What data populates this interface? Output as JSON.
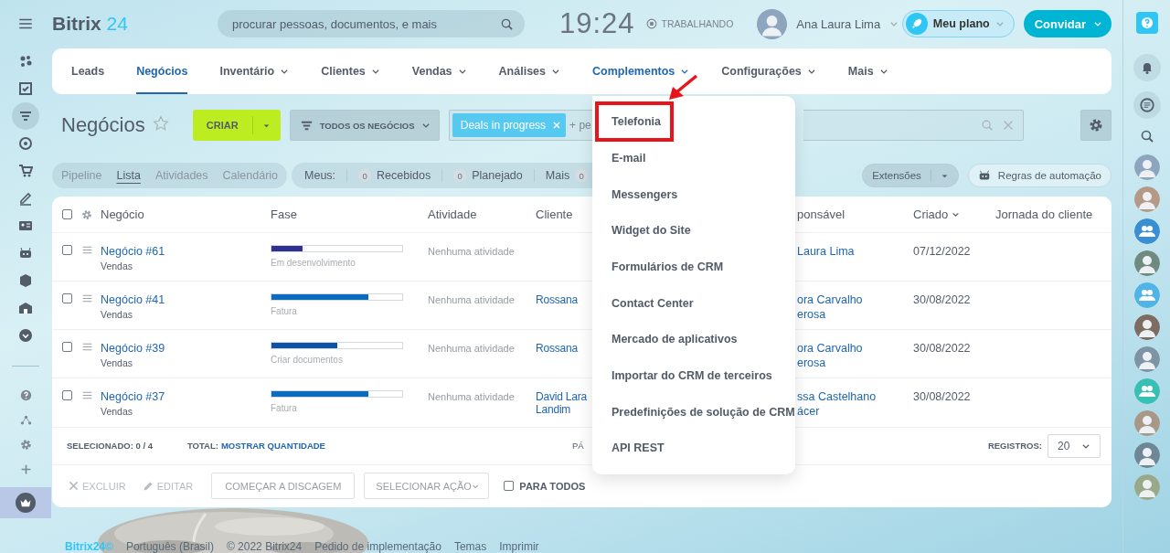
{
  "header": {
    "logo_main": "Bitrix",
    "logo_accent": "24",
    "search": {
      "placeholder": "procurar pessoas, documentos, e mais"
    },
    "clock": "19:24",
    "work_status": "TRABALHANDO",
    "user_name": "Ana Laura Lima",
    "plan_button": "Meu plano",
    "invite_button": "Convidar"
  },
  "nav_tabs": [
    {
      "label": "Leads",
      "selected": false,
      "dropdown": false
    },
    {
      "label": "Negócios",
      "selected": true,
      "dropdown": false
    },
    {
      "label": "Inventário",
      "selected": false,
      "dropdown": true
    },
    {
      "label": "Clientes",
      "selected": false,
      "dropdown": true
    },
    {
      "label": "Vendas",
      "selected": false,
      "dropdown": true
    },
    {
      "label": "Análises",
      "selected": false,
      "dropdown": true
    },
    {
      "label": "Complementos",
      "selected": false,
      "dropdown": true,
      "expanded": true
    },
    {
      "label": "Configurações",
      "selected": false,
      "dropdown": true
    },
    {
      "label": "Mais",
      "selected": false,
      "dropdown": true
    }
  ],
  "dropdown_menu": [
    {
      "label": "Telefonia",
      "highlighted": true
    },
    {
      "label": "E-mail",
      "highlighted": false
    },
    {
      "label": "Messengers",
      "highlighted": false
    },
    {
      "label": "Widget do Site",
      "highlighted": false
    },
    {
      "label": "Formulários de CRM",
      "highlighted": false
    },
    {
      "label": "Contact Center",
      "highlighted": false
    },
    {
      "label": "Mercado de aplicativos",
      "highlighted": false
    },
    {
      "label": "Importar do CRM de terceiros",
      "highlighted": false
    },
    {
      "label": "Predefinições de solução de CRM",
      "highlighted": false
    },
    {
      "label": "API REST",
      "highlighted": false
    }
  ],
  "toolbar": {
    "title": "Negócios",
    "create_button": "CRIAR",
    "filter_preset": "TODOS OS NEGÓCIOS",
    "filter_tag": "Deals in progress",
    "filter_more": "+ pe"
  },
  "view_tabs": [
    {
      "label": "Pipeline",
      "selected": false
    },
    {
      "label": "Lista",
      "selected": true
    },
    {
      "label": "Atividades",
      "selected": false
    },
    {
      "label": "Calendário",
      "selected": false
    }
  ],
  "counters": {
    "label": "Meus:",
    "items": [
      {
        "kind": "prefix",
        "count": "0",
        "label": "Recebidos"
      },
      {
        "kind": "prefix",
        "count": "0",
        "label": "Planejado"
      },
      {
        "kind": "suffix",
        "count": "0",
        "label": "Mais"
      }
    ]
  },
  "extensions_button": "Extensões",
  "automation_button": "Regras de automação",
  "table": {
    "all_checked": false,
    "columns": [
      {
        "label": "Negócio",
        "sorted": false
      },
      {
        "label": "Fase",
        "sorted": false
      },
      {
        "label": "Atividade",
        "sorted": false
      },
      {
        "label": "Cliente",
        "sorted": false
      },
      {
        "label": "ponsável",
        "sorted": false
      },
      {
        "label": "Criado",
        "sorted": true
      },
      {
        "label": "Jornada do cliente",
        "sorted": false
      }
    ],
    "rows": [
      {
        "checked": false,
        "title": "Negócio #61",
        "pipeline": "Vendas",
        "stage": "Em desenvolvimento",
        "level": 0.24,
        "color": "#2e3192",
        "activity": "Nenhuma atividade",
        "responsible": [
          "Laura Lima"
        ],
        "created": "07/12/2022"
      },
      {
        "checked": false,
        "title": "Negócio #41",
        "pipeline": "Vendas",
        "stage": "Fatura",
        "level": 0.74,
        "color": "#0b6bbd",
        "activity": "Nenhuma atividade",
        "client": "Rossana",
        "responsible": [
          "ora Carvalho",
          "erosa"
        ],
        "created": "30/08/2022"
      },
      {
        "checked": false,
        "title": "Negócio #39",
        "pipeline": "Vendas",
        "stage": "Criar documentos",
        "level": 0.5,
        "color": "#0b52a8",
        "activity": "Nenhuma atividade",
        "client": "Rossana",
        "responsible": [
          "ora Carvalho",
          "erosa"
        ],
        "created": "30/08/2022"
      },
      {
        "checked": false,
        "title": "Negócio #37",
        "pipeline": "Vendas",
        "stage": "Fatura",
        "level": 0.74,
        "color": "#0b6bbd",
        "activity": "Nenhuma atividade",
        "client": "David Lara Landim",
        "responsible": [
          "ssa Castelhano",
          "ácer"
        ],
        "created": "30/08/2022"
      }
    ]
  },
  "table_footer": {
    "selected_label": "SELECIONADO:",
    "selected_value": "0 / 4",
    "total_label": "TOTAL:",
    "total_link": "MOSTRAR QUANTIDADE",
    "pages_label": "PÁ",
    "records_label": "REGISTROS:",
    "records_value": "20"
  },
  "actions": [
    {
      "kind": "delete",
      "label": "EXCLUIR",
      "disabled": true
    },
    {
      "kind": "edit",
      "label": "EDITAR",
      "disabled": true
    },
    {
      "kind": "button",
      "label": "COMEÇAR A DISCAGEM"
    },
    {
      "kind": "select",
      "label": "SELECIONAR AÇÃO"
    },
    {
      "kind": "checkbox",
      "label": "PARA TODOS",
      "checked": false
    }
  ],
  "page_footer": [
    "Bitrix24©",
    "Português (Brasil)",
    "© 2022 Bitrix24",
    "Pedido de implementação",
    "Temas",
    "Imprimir"
  ]
}
